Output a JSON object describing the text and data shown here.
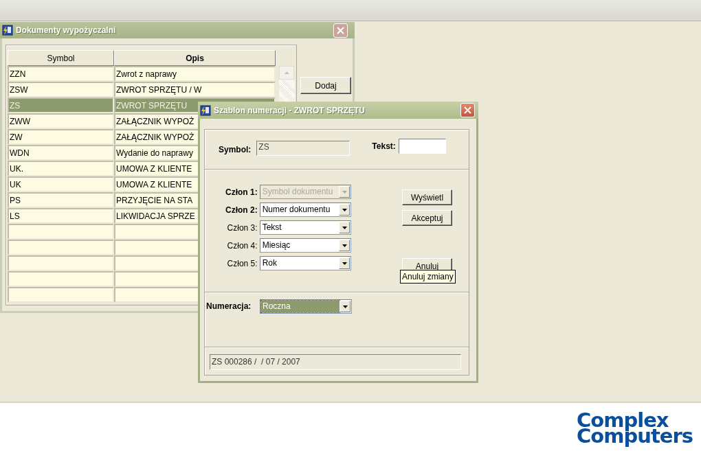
{
  "documents_window": {
    "title": "Dokumenty wypożyczalni",
    "table": {
      "columns": [
        {
          "label": "Symbol",
          "sorted": false
        },
        {
          "label": "Opis",
          "sorted": true
        }
      ],
      "rows": [
        {
          "symbol": "ZZN",
          "description": "Zwrot z naprawy",
          "selected": false
        },
        {
          "symbol": "ZSW",
          "description": "ZWROT SPRZĘTU / W",
          "selected": false
        },
        {
          "symbol": "ZS",
          "description": "ZWROT SPRZĘTU",
          "selected": true
        },
        {
          "symbol": "ZWW",
          "description": "ZAŁĄCZNIK WYPOŻ",
          "selected": false
        },
        {
          "symbol": "ZW",
          "description": "ZAŁĄCZNIK WYPOŻ",
          "selected": false
        },
        {
          "symbol": "WDN",
          "description": "Wydanie do naprawy",
          "selected": false
        },
        {
          "symbol": "UK.",
          "description": "UMOWA Z KLIENTE",
          "selected": false
        },
        {
          "symbol": "UK",
          "description": "UMOWA Z KLIENTE",
          "selected": false
        },
        {
          "symbol": "PS",
          "description": "PRZYJĘCIE NA STA",
          "selected": false
        },
        {
          "symbol": "LS",
          "description": "LIKWIDACJA SPRZE",
          "selected": false
        }
      ]
    },
    "buttons": [
      "Dodaj"
    ]
  },
  "template_dialog": {
    "title": "Szablon numeracji - ZWROT SPRZĘTU",
    "symbol": {
      "label": "Symbol:",
      "value": "ZS",
      "disabled": true
    },
    "text_field": {
      "label": "Tekst:"
    },
    "segments": [
      {
        "label": "Człon 1:",
        "value": "Symbol dokumentu",
        "emphasized": true,
        "disabled": true
      },
      {
        "label": "Człon 2:",
        "value": "Numer dokumentu",
        "emphasized": true,
        "disabled": false
      },
      {
        "label": "Człon 3:",
        "value": "Tekst",
        "emphasized": false,
        "disabled": false
      },
      {
        "label": "Człon 4:",
        "value": "Miesiąc",
        "emphasized": false,
        "disabled": false
      },
      {
        "label": "Człon 5:",
        "value": "Rok",
        "emphasized": false,
        "disabled": false
      }
    ],
    "buttons": [
      "Wyświetl",
      "Akceptuj",
      "Anuluj"
    ],
    "tooltip": "Anuluj zmiany",
    "numbering": {
      "label": "Numeracja:",
      "value": "Roczna",
      "focused": true
    },
    "preview": "ZS 000286 /  / 07 / 2007"
  },
  "logo": {
    "line_1": "Complex",
    "line_2": "Computers"
  }
}
